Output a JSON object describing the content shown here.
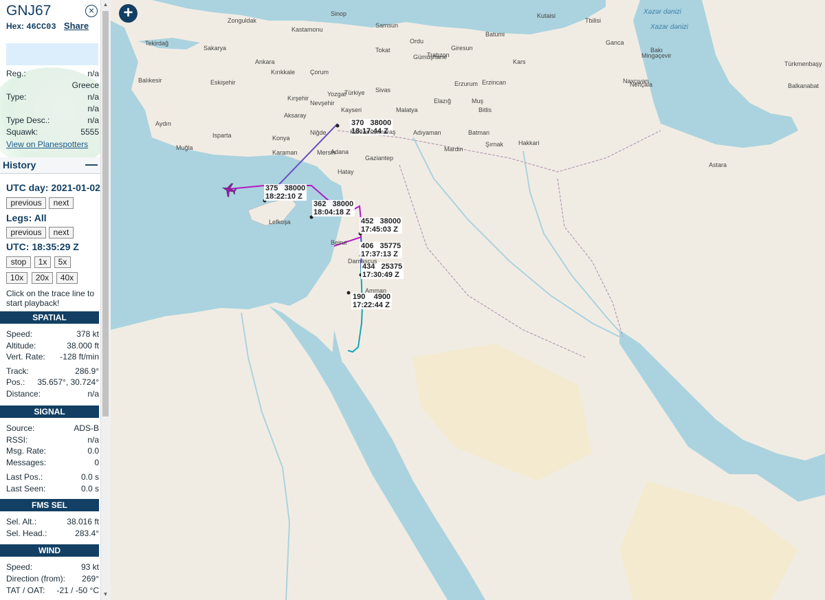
{
  "aircraft": {
    "callsign": "GNJ67",
    "hex_label": "Hex:",
    "hex": "46CC03",
    "share_label": "Share"
  },
  "info": {
    "reg_label": "Reg.:",
    "reg": "n/a",
    "country": "Greece",
    "type_label": "Type:",
    "type": "n/a",
    "type_extra": "n/a",
    "type_desc_label": "Type Desc.:",
    "type_desc": "n/a",
    "squawk_label": "Squawk:",
    "squawk": "5555",
    "planespotters_link": "View on Planespotters"
  },
  "history": {
    "title": "History",
    "collapse_icon": "—",
    "utc_day": "UTC day: 2021-01-02",
    "prev_label": "previous",
    "next_label": "next",
    "legs": "Legs: All",
    "utc_time": "UTC: 18:35:29 Z",
    "stop_label": "stop",
    "speeds": [
      "1x",
      "5x",
      "10x",
      "20x",
      "40x"
    ],
    "note": "Click on the trace line to start playback!"
  },
  "spatial": {
    "title": "SPATIAL",
    "rows": [
      {
        "label": "Speed:",
        "value": "378 kt"
      },
      {
        "label": "Altitude:",
        "value": "38.000 ft"
      },
      {
        "label": "Vert. Rate:",
        "value": "-128 ft/min"
      },
      {
        "label": "Track:",
        "value": "286.9°"
      },
      {
        "label": "Pos.:",
        "value": "35.657°, 30.724°"
      },
      {
        "label": "Distance:",
        "value": "n/a"
      }
    ]
  },
  "signal": {
    "title": "SIGNAL",
    "rows": [
      {
        "label": "Source:",
        "value": "ADS-B"
      },
      {
        "label": "RSSI:",
        "value": "n/a"
      },
      {
        "label": "Msg. Rate:",
        "value": "0.0"
      },
      {
        "label": "Messages:",
        "value": "0"
      },
      {
        "label": "Last Pos.:",
        "value": "0.0 s"
      },
      {
        "label": "Last Seen:",
        "value": "0.0 s"
      }
    ]
  },
  "fms": {
    "title": "FMS SEL",
    "rows": [
      {
        "label": "Sel. Alt.:",
        "value": "38.016 ft"
      },
      {
        "label": "Sel. Head.:",
        "value": "283.4°"
      }
    ]
  },
  "wind": {
    "title": "WIND",
    "rows": [
      {
        "label": "Speed:",
        "value": "93 kt"
      },
      {
        "label": "Direction (from):",
        "value": "269°"
      },
      {
        "label": "TAT / OAT:",
        "value": "-21 / -50 °C"
      }
    ]
  },
  "map": {
    "zoom_button": "+",
    "track_labels": [
      {
        "l1": "370   38000",
        "l2": "18:17:44 Z"
      },
      {
        "l1": "375   38000",
        "l2": "18:22:10 Z"
      },
      {
        "l1": "362   38000",
        "l2": "18:04:18 Z"
      },
      {
        "l1": "452   38000",
        "l2": "17:45:03 Z"
      },
      {
        "l1": "406   35775",
        "l2": "17:37:13 Z"
      },
      {
        "l1": "434   25375",
        "l2": "17:30:49 Z"
      },
      {
        "l1": "190    4900",
        "l2": "17:22:44 Z"
      }
    ],
    "places": [
      "Tekirdağ",
      "Zonguldak",
      "Sakarya",
      "Kastamonu",
      "Sinop",
      "Samsun",
      "Ordu",
      "Trabzon",
      "Batumi",
      "Kutaisi",
      "Tbilisi",
      "Ganca",
      "Mingəçevir",
      "Bakı",
      "Balıkesir",
      "Ankara",
      "Kırıkkale",
      "Çorum",
      "Tokat",
      "Giresun",
      "Gümüşhane",
      "Erzurum",
      "Kars",
      "Naxçıvan",
      "Türkiye",
      "Eskişehir",
      "Kırşehir",
      "Yozgat",
      "Sivas",
      "Erzincan",
      "Elazığ",
      "Muş",
      "Bitlis",
      "Aksaray",
      "Nevşehir",
      "Kayseri",
      "Malatya",
      "Aydın",
      "Isparta",
      "Konya",
      "Niğde",
      "Adıyaman",
      "Batman",
      "Şırnak",
      "Hakkari",
      "Muğla",
      "Karaman",
      "Mersin",
      "Adana",
      "Kahramanmaraş",
      "Gaziantep",
      "Mardin",
      "Hatay",
      "Lefkoşa",
      "Beirut",
      "Damascus",
      "Amman",
      "Türkmenbaşy",
      "Balkanabat",
      "Neftçala",
      "Astara"
    ],
    "water_labels": [
      "Xəzər dənizi",
      "Xazar dənizi"
    ]
  }
}
